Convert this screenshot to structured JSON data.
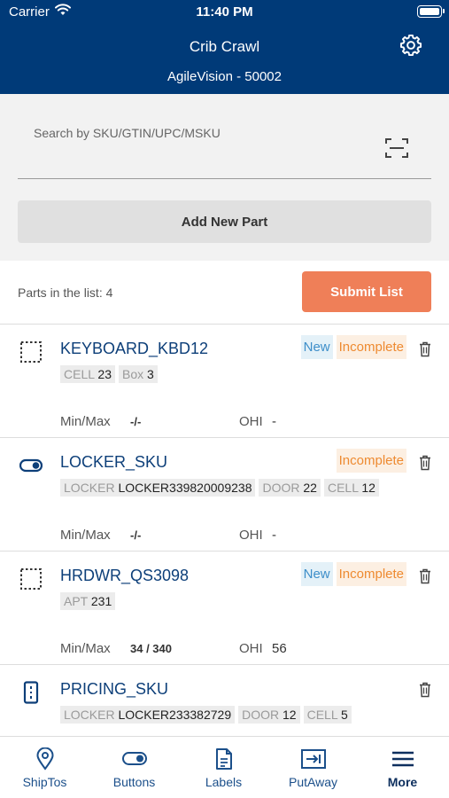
{
  "status_bar": {
    "carrier": "Carrier",
    "time": "11:40 PM"
  },
  "header": {
    "title": "Crib Crawl",
    "subtitle": "AgileVision - 50002",
    "settings_icon": "gear-icon"
  },
  "search": {
    "placeholder": "Search by SKU/GTIN/UPC/MSKU",
    "value": "",
    "scan_icon": "barcode-scan-icon"
  },
  "add_part_label": "Add New Part",
  "list": {
    "count_text": "Parts in the list: 4",
    "submit_label": "Submit List"
  },
  "items": [
    {
      "name": "KEYBOARD_KBD12",
      "icon": "dotted-square-icon",
      "badges": [
        "New",
        "Incomplete"
      ],
      "tags": [
        {
          "k": "CELL",
          "v": "23"
        },
        {
          "k": "Box",
          "v": "3"
        }
      ],
      "minmax_label": "Min/Max",
      "minmax": "-/-",
      "ohi_label": "OHI",
      "ohi": "-"
    },
    {
      "name": "LOCKER_SKU",
      "icon": "toggle-icon",
      "badges": [
        "Incomplete"
      ],
      "tags": [
        {
          "k": "LOCKER",
          "v": "LOCKER339820009238"
        },
        {
          "k": "DOOR",
          "v": "22"
        },
        {
          "k": "CELL",
          "v": "12"
        }
      ],
      "minmax_label": "Min/Max",
      "minmax": "-/-",
      "ohi_label": "OHI",
      "ohi": "-"
    },
    {
      "name": "HRDWR_QS3098",
      "icon": "dotted-square-icon",
      "badges": [
        "New",
        "Incomplete"
      ],
      "tags": [
        {
          "k": "APT",
          "v": "231"
        }
      ],
      "minmax_label": "Min/Max",
      "minmax": "34 / 340",
      "ohi_label": "OHI",
      "ohi": "56"
    },
    {
      "name": "PRICING_SKU",
      "icon": "vending-machine-icon",
      "badges": [],
      "tags": [
        {
          "k": "LOCKER",
          "v": "LOCKER233382729"
        },
        {
          "k": "DOOR",
          "v": "12"
        },
        {
          "k": "CELL",
          "v": "5"
        }
      ]
    }
  ],
  "tabs": [
    {
      "label": "ShipTos",
      "icon": "location-pin-icon"
    },
    {
      "label": "Buttons",
      "icon": "toggle-icon"
    },
    {
      "label": "Labels",
      "icon": "document-icon"
    },
    {
      "label": "PutAway",
      "icon": "putaway-icon"
    },
    {
      "label": "More",
      "icon": "menu-icon"
    }
  ],
  "colors": {
    "header": "#003a78",
    "accent": "#ef7f58",
    "link": "#0d3f79",
    "badge_new": "#3d8ec9",
    "badge_incomplete": "#ee8a30"
  }
}
